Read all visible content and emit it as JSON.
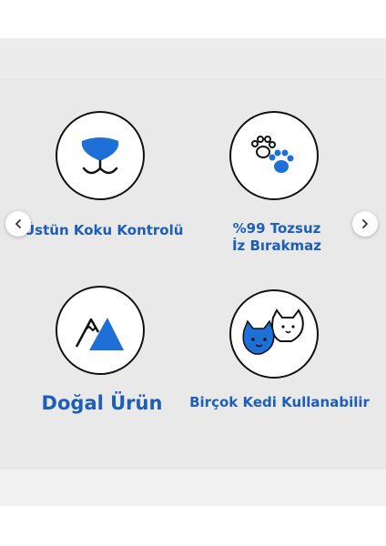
{
  "features": [
    {
      "label": "Üstün Koku Kontrolü",
      "icon": "cat-nose-icon"
    },
    {
      "label_line1": "%99 Tozsuz",
      "label_line2": "İz Bırakmaz",
      "icon": "paw-prints-icon"
    },
    {
      "label": "Doğal Ürün",
      "icon": "mountain-icon"
    },
    {
      "label": "Birçok Kedi Kullanabilir",
      "icon": "cats-icon"
    }
  ],
  "carousel": {
    "prev_icon": "chevron-left-icon",
    "next_icon": "chevron-right-icon"
  },
  "colors": {
    "accent": "#1d5fb8",
    "icon_blue": "#1e6fd6",
    "outline": "#111111",
    "panel": "#e9e9e9"
  }
}
